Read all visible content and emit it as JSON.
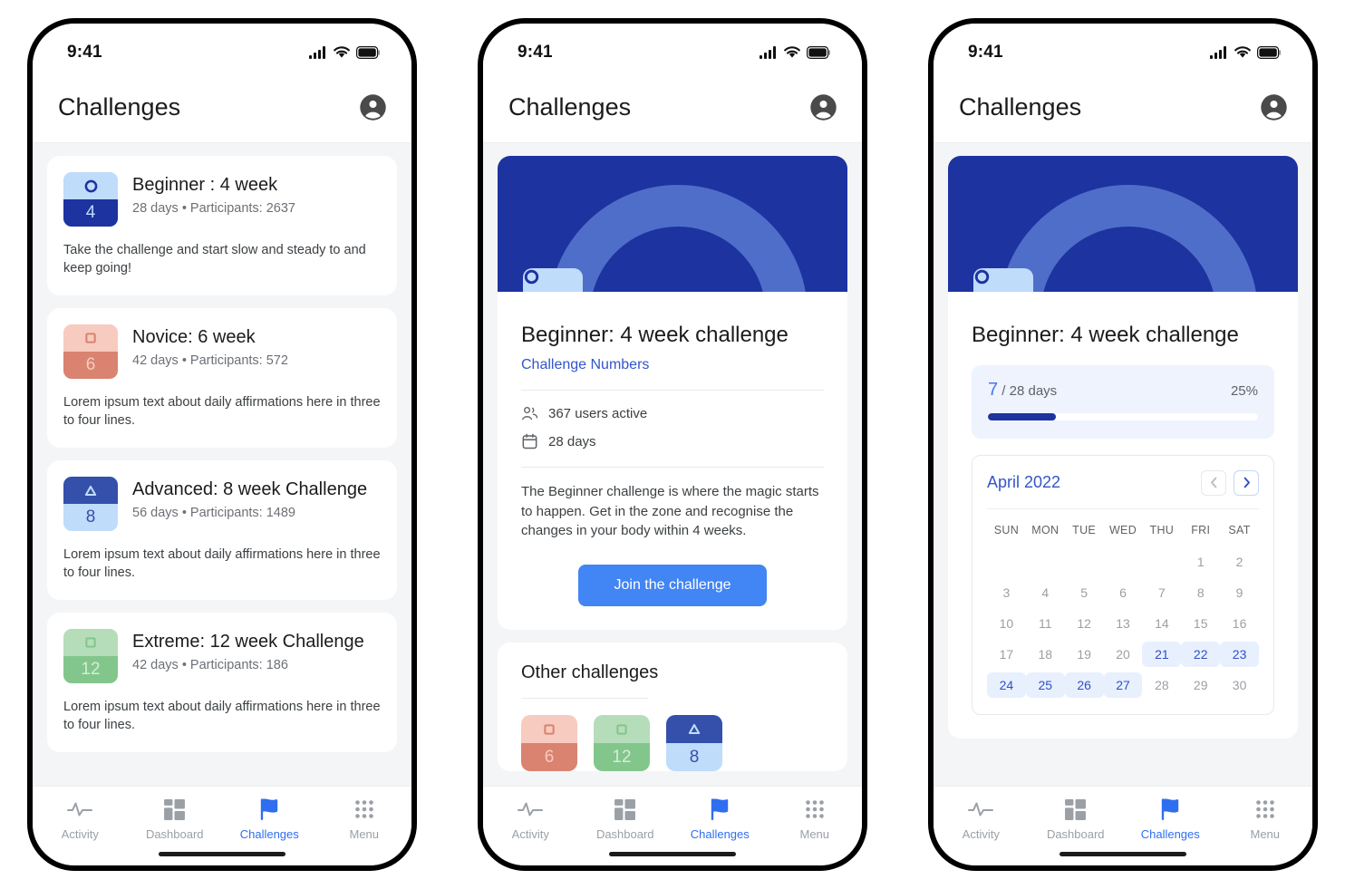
{
  "colors": {
    "brand_navy": "#1d33a0",
    "brand_blue": "#4285f4",
    "link_blue": "#3355c9",
    "nav_active": "#2f6ef0",
    "muted": "#9aa0a6",
    "screen_bg": "#f4f5f7",
    "progress_panel": "#eef3fd",
    "calendar_active_bg": "#e8f0fe"
  },
  "status_bar": {
    "time": "9:41",
    "icons": [
      "cellular-signal-icon",
      "wifi-icon",
      "battery-icon"
    ]
  },
  "app_bar": {
    "title": "Challenges",
    "avatar_icon": "account-circle-icon"
  },
  "bottom_nav": {
    "items": [
      {
        "label": "Activity",
        "icon": "activity-pulse-icon",
        "active": false
      },
      {
        "label": "Dashboard",
        "icon": "dashboard-grid-icon",
        "active": false
      },
      {
        "label": "Challenges",
        "icon": "flag-icon",
        "active": true
      },
      {
        "label": "Menu",
        "icon": "dots-grid-icon",
        "active": false
      }
    ]
  },
  "screen1": {
    "challenges": [
      {
        "title": "Beginner : 4 week",
        "meta": "28 days • Participants: 2637",
        "description": "Take the challenge and start slow and steady to and keep going!",
        "badge": {
          "number": "4",
          "shape": "circle",
          "top_bg": "#bfdcfb",
          "bottom_bg": "#1d33a0",
          "shape_color": "#1d33a0",
          "number_color": "#bfdcfb"
        }
      },
      {
        "title": "Novice: 6 week",
        "meta": "42 days • Participants: 572",
        "description": "Lorem ipsum text about daily affirmations here in three to four lines.",
        "badge": {
          "number": "6",
          "shape": "square",
          "top_bg": "#f7cbbf",
          "bottom_bg": "#d98370",
          "shape_color": "#d98370",
          "number_color": "#f7cbbf"
        }
      },
      {
        "title": "Advanced: 8 week Challenge",
        "meta": "56 days • Participants: 1489",
        "description": "Lorem ipsum text about daily affirmations here in three to four lines.",
        "badge": {
          "number": "8",
          "shape": "triangle",
          "top_bg": "#3450ab",
          "bottom_bg": "#bfdcfb",
          "shape_color": "#bfdcfb",
          "number_color": "#3450ab"
        }
      },
      {
        "title": "Extreme: 12 week Challenge",
        "meta": "42 days • Participants: 186",
        "description": "Lorem ipsum text about daily affirmations here in three to four lines.",
        "badge": {
          "number": "12",
          "shape": "square",
          "top_bg": "#b6ddb9",
          "bottom_bg": "#82c68c",
          "shape_color": "#82c68c",
          "number_color": "#d6ecd8"
        }
      }
    ]
  },
  "screen2": {
    "hero": {
      "banner_bg": "#1d33a0",
      "arc_color": "#4f6ec9",
      "badge": {
        "number": "4",
        "shape": "circle",
        "top_bg": "#bfdcfb",
        "bottom_bg": "#1d33a0",
        "shape_color": "#1d33a0",
        "number_color": "#bfdcfb"
      }
    },
    "title": "Beginner: 4 week challenge",
    "link": "Challenge Numbers",
    "stats": [
      {
        "icon": "people-icon",
        "text": "367 users active"
      },
      {
        "icon": "calendar-icon",
        "text": "28 days"
      }
    ],
    "description": "The Beginner challenge is where the magic starts to happen. Get in the zone and recognise the changes in your body within 4 weeks.",
    "join_button": "Join the challenge",
    "other": {
      "title": "Other challenges",
      "badges": [
        {
          "number": "6",
          "shape": "square",
          "top_bg": "#f7cbbf",
          "bottom_bg": "#d98370",
          "shape_color": "#d98370",
          "number_color": "#f7cbbf"
        },
        {
          "number": "12",
          "shape": "square",
          "top_bg": "#b6ddb9",
          "bottom_bg": "#82c68c",
          "shape_color": "#82c68c",
          "number_color": "#d6ecd8"
        },
        {
          "number": "8",
          "shape": "triangle",
          "top_bg": "#3450ab",
          "bottom_bg": "#bfdcfb",
          "shape_color": "#bfdcfb",
          "number_color": "#3450ab"
        }
      ]
    }
  },
  "screen3": {
    "hero": {
      "banner_bg": "#1d33a0",
      "arc_color": "#4f6ec9",
      "badge": {
        "number": "4",
        "shape": "circle",
        "top_bg": "#bfdcfb",
        "bottom_bg": "#1d33a0",
        "shape_color": "#1d33a0",
        "number_color": "#bfdcfb"
      }
    },
    "title": "Beginner: 4 week challenge",
    "progress": {
      "current_day": "7",
      "total_label": "/ 28 days",
      "percent_label": "25%",
      "percent_value": 25
    },
    "calendar": {
      "month_label": "April 2022",
      "prev_icon": "chevron-left-icon",
      "next_icon": "chevron-right-icon",
      "day_headers": [
        "SUN",
        "MON",
        "TUE",
        "WED",
        "THU",
        "FRI",
        "SAT"
      ],
      "leading_blanks": 5,
      "days": [
        1,
        2,
        3,
        4,
        5,
        6,
        7,
        8,
        9,
        10,
        11,
        12,
        13,
        14,
        15,
        16,
        17,
        18,
        19,
        20,
        21,
        22,
        23,
        24,
        25,
        26,
        27,
        28,
        29,
        30
      ],
      "highlighted_days": [
        21,
        22,
        23,
        24,
        25,
        26,
        27
      ]
    }
  }
}
